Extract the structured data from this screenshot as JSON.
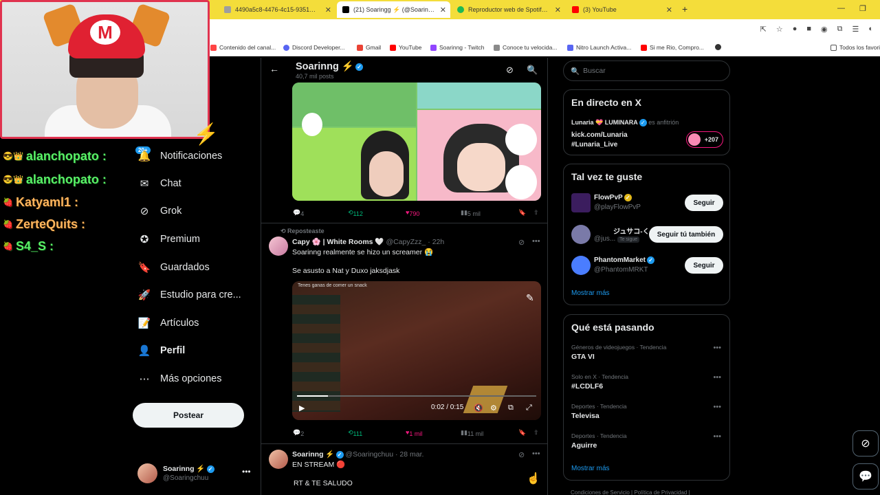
{
  "browser": {
    "tabs": [
      {
        "label": "4490a5c8-4476-4c15-9351-ff2",
        "active": false
      },
      {
        "label": "(21) Soaringg ⚡ (@Soaringchu",
        "active": true
      },
      {
        "label": "Reproductor web de Spotify: m",
        "active": false
      },
      {
        "label": "(3) YouTube",
        "active": false
      }
    ],
    "bookmarks": [
      "Contenido del canal...",
      "Discord Developer...",
      "Gmail",
      "YouTube",
      "Soarinng - Twitch",
      "Conoce tu velocida...",
      "Nitro Launch Activa...",
      "Si me Rio, Compro...",
      "Todos los favoritos"
    ]
  },
  "stream_chat": [
    {
      "user": "alanchopato",
      "suffix": ":",
      "color": "green"
    },
    {
      "user": "alanchopato",
      "suffix": ":",
      "color": "green"
    },
    {
      "user": "Katyaml1",
      "suffix": ":",
      "color": "orange"
    },
    {
      "user": "ZerteQuits",
      "suffix": ":",
      "color": "orange"
    },
    {
      "user": "S4_S",
      "suffix": ":",
      "color": "green"
    }
  ],
  "nav": {
    "notifications_badge": "20+",
    "items": [
      {
        "label": "Notificaciones",
        "icon": "bell-icon"
      },
      {
        "label": "Chat",
        "icon": "mail-icon"
      },
      {
        "label": "Grok",
        "icon": "grok-icon"
      },
      {
        "label": "Premium",
        "icon": "premium-icon"
      },
      {
        "label": "Guardados",
        "icon": "bookmark-icon"
      },
      {
        "label": "Estudio para cre...",
        "icon": "rocket-icon"
      },
      {
        "label": "Artículos",
        "icon": "article-icon"
      },
      {
        "label": "Perfil",
        "icon": "person-icon"
      },
      {
        "label": "Más opciones",
        "icon": "more-circle-icon"
      }
    ],
    "post_button": "Postear",
    "account": {
      "name": "Soarinng ⚡",
      "handle": "@Soaringchuu"
    }
  },
  "main": {
    "header": {
      "title": "Soarinng ⚡",
      "subtitle": "40,7 mil posts"
    },
    "post1": {
      "replies": "4",
      "reposts": "112",
      "likes": "790",
      "views": "5 mil"
    },
    "post2": {
      "repost_label": "Reposteaste",
      "name": "Capy 🌸 | White Rooms 🤍",
      "handle": "@CapyZzz_",
      "time": "· 22h",
      "text1": "Soarinng realmente se hizo un screamer 😭",
      "text2": "Se asusto a Nat y Duxo jaksdjask",
      "video_caption": "Tenes ganas de comer un snack",
      "video_time": "0:02 / 0:15",
      "video_progress": 0.13,
      "replies": "2",
      "reposts": "111",
      "likes": "1 mil",
      "views": "11 mil"
    },
    "post3": {
      "name": "Soarinng ⚡",
      "handle": "@Soaringchuu",
      "time": "· 28 mar.",
      "text1": "EN STREAM 🔴",
      "text2": "RT & TE SALUDO"
    }
  },
  "sidebar": {
    "search_placeholder": "Buscar",
    "live": {
      "title": "En directo en X",
      "host": "Lunaria 💝 LUMINARA",
      "host_suffix": "es anfitrión",
      "line1": "kick.com/Lunaria",
      "line2": "#Lunaria_Live",
      "listeners": "+207"
    },
    "follow": {
      "title": "Tal vez te guste",
      "users": [
        {
          "name": "FlowPvP",
          "handle": "@playFlowPvP",
          "button": "Seguir",
          "follows_you": ""
        },
        {
          "name": "ジュサコ-くん",
          "handle": "@jus...",
          "button": "Seguir tú también",
          "follows_you": "Te sigue"
        },
        {
          "name": "PhantomMarket",
          "handle": "@PhantomMRKT",
          "button": "Seguir",
          "follows_you": ""
        }
      ],
      "show_more": "Mostrar más"
    },
    "trends": {
      "title": "Qué está pasando",
      "items": [
        {
          "meta": "Géneros de videojuegos · Tendencia",
          "name": "GTA VI"
        },
        {
          "meta": "Solo en X · Tendencia",
          "name": "#LCDLF6"
        },
        {
          "meta": "Deportes · Tendencia",
          "name": "Televisa"
        },
        {
          "meta": "Deportes · Tendencia",
          "name": "Aguirre"
        }
      ],
      "show_more": "Mostrar más"
    },
    "footer": "Condiciones de Servicio | Política de Privacidad |"
  }
}
